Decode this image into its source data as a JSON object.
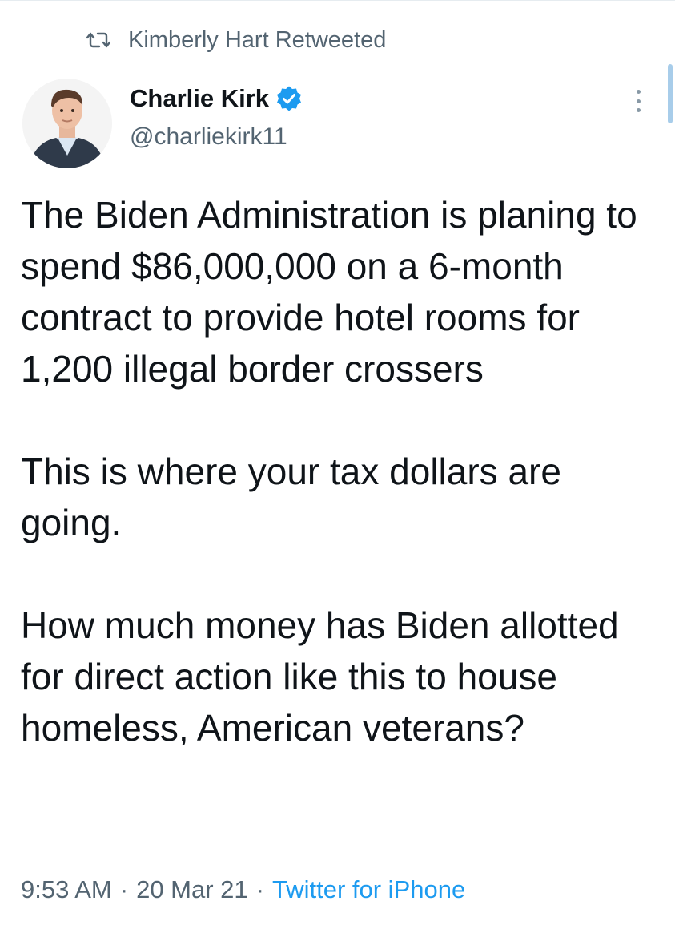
{
  "retweet": {
    "label": "Kimberly Hart Retweeted"
  },
  "author": {
    "display_name": "Charlie Kirk",
    "handle": "@charliekirk11",
    "verified": true
  },
  "tweet": {
    "paragraphs": [
      "The Biden Administration is planing to spend $86,000,000 on a 6-month contract to provide hotel rooms for 1,200 illegal border crossers",
      "This is where your tax dollars are going.",
      "How much money has Biden allotted for direct action like this to house homeless, American veterans?"
    ]
  },
  "meta": {
    "time": "9:53 AM",
    "separator": "·",
    "date": "20 Mar 21",
    "source": "Twitter for iPhone"
  },
  "colors": {
    "text_primary": "#0f1419",
    "text_secondary": "#536471",
    "accent_blue": "#1d9bf0"
  },
  "icons": {
    "retweet": "retweet-icon",
    "verified": "verified-badge-icon",
    "more": "more-options-icon"
  }
}
